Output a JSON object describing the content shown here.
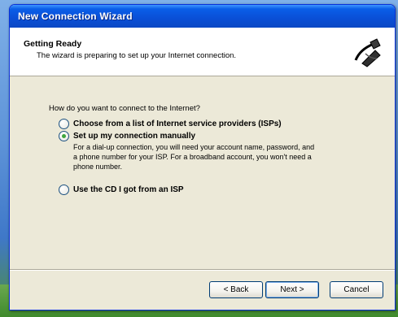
{
  "window": {
    "title": "New Connection Wizard"
  },
  "header": {
    "title": "Getting Ready",
    "subtitle": "The wizard is preparing to set up your Internet connection.",
    "icon": "connection-wizard-icon"
  },
  "content": {
    "question": "How do you want to connect to the Internet?",
    "options": [
      {
        "label": "Choose from a list of Internet service providers (ISPs)",
        "selected": false
      },
      {
        "label": "Set up my connection manually",
        "selected": true
      },
      {
        "label": "Use the CD I got from an ISP",
        "selected": false
      }
    ],
    "manual_description": "For a dial-up connection, you will need your account name, password, and a phone number for your ISP. For a broadband account, you won't need a phone number."
  },
  "buttons": {
    "back": "< Back",
    "next": "Next >",
    "cancel": "Cancel"
  },
  "colors": {
    "titlebar": "#0a4fd6",
    "window_bg": "#ece9d8",
    "selected_radio": "#3ea53e"
  }
}
